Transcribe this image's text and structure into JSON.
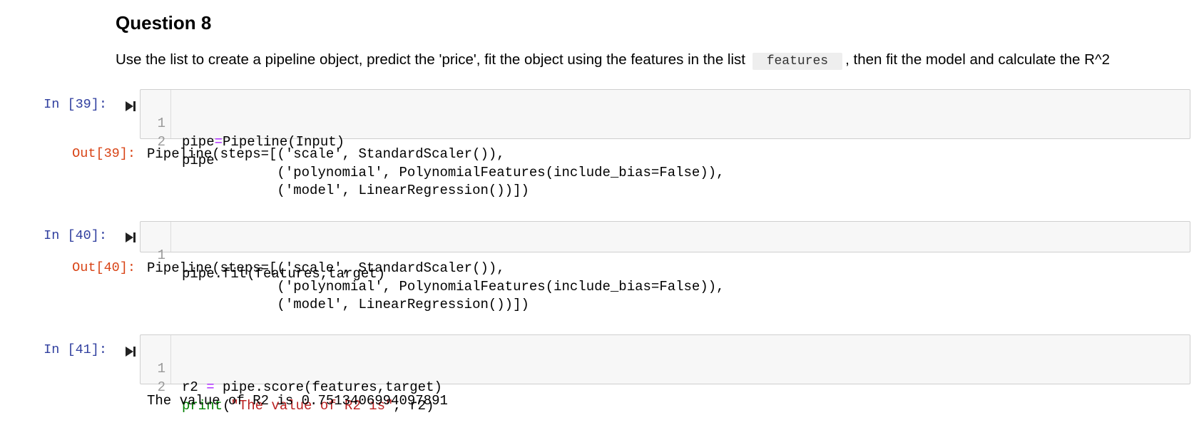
{
  "heading": "Question 8",
  "instruction": {
    "before": "Use the list to create a pipeline object, predict the 'price', fit the object using the features in the list",
    "code": "features",
    "after": ", then fit the model and calculate the R^2"
  },
  "cells": [
    {
      "in_prompt": "In [39]:",
      "lines": [
        {
          "num": "1",
          "parts": [
            "pipe",
            "=",
            "Pipeline(Input)"
          ]
        },
        {
          "num": "2",
          "text": "pipe"
        }
      ],
      "out_prompt": "Out[39]:",
      "output": [
        "Pipeline(steps=[('scale', StandardScaler()),",
        "                ('polynomial', PolynomialFeatures(include_bias=False)),",
        "                ('model', LinearRegression())])"
      ]
    },
    {
      "in_prompt": "In [40]:",
      "lines": [
        {
          "num": "1",
          "text": "pipe.fit(features,target)"
        }
      ],
      "out_prompt": "Out[40]:",
      "output": [
        "Pipeline(steps=[('scale', StandardScaler()),",
        "                ('polynomial', PolynomialFeatures(include_bias=False)),",
        "                ('model', LinearRegression())])"
      ]
    },
    {
      "in_prompt": "In [41]:",
      "lines": [
        {
          "num": "1",
          "parts": [
            "r2 ",
            "=",
            " pipe.score(features,target)"
          ]
        },
        {
          "num": "2",
          "parts": [
            "print",
            "(",
            "\"The value of R2 is\"",
            ", r2)"
          ]
        }
      ],
      "output": [
        "The value of R2 is 0.7513406994097891"
      ]
    }
  ],
  "icons": {
    "run": "run-cell-icon"
  },
  "colors": {
    "in_prompt": "#303f9f",
    "out_prompt": "#d84315",
    "keyword_operator": "#aa22ff",
    "builtin": "#008000",
    "string": "#ba2121",
    "cell_background": "#f7f7f7",
    "cell_border": "#cfcfcf"
  }
}
